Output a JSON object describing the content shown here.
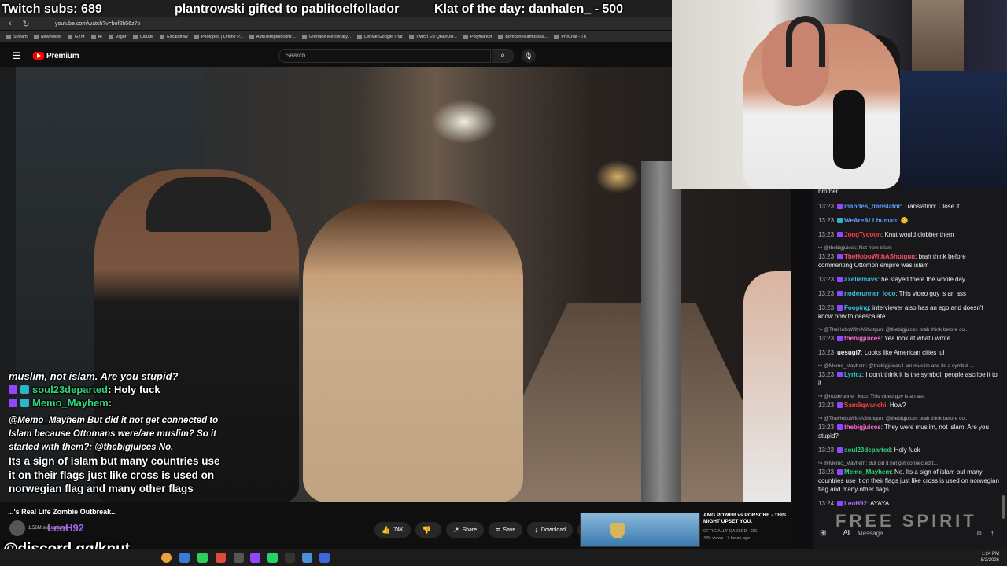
{
  "overlay": {
    "twitch_subs": "Twitch subs: 689",
    "gift": "plantrowski gifted to pablitoelfollador",
    "klat": "Klat of the day: danhalen_ - 500",
    "discord": "@discord.gg/knut",
    "watermark": "FREE SPIRIT"
  },
  "browser": {
    "url": "youtube.com/watch?v=bof2h56z7o",
    "bookmarks": [
      "Stream",
      "New folder",
      "GYM",
      "AI",
      "Viiger",
      "Claude",
      "Excalidraw",
      "Photopea | Online P...",
      "AutoTempest.com:...",
      "Grenade Mercenary...",
      "Let Me Google That",
      "Twitch EB QHD/UH...",
      "Polymarket",
      "Bombshell ambassa...",
      "ProChat - Th"
    ]
  },
  "youtube": {
    "logo_text": "Premium",
    "search_placeholder": "Search",
    "video_title_partial": "...'s Real Life Zombie Outbreak...",
    "channel_sub_count": "1.56M subscribers",
    "overlay_user": "LeoH92",
    "actions": {
      "likes": "74K",
      "share": "Share",
      "save": "Save",
      "download": "Download"
    },
    "recommended": {
      "title": "AMG POWER vs PORSCHE - THIS MIGHT UPSET YOU.",
      "channel": "OFFICIALLY GASSED - OG",
      "meta": "47K views • 7 hours ago"
    }
  },
  "video_chat": [
    {
      "type": "text",
      "text": "muslim, not islam. Are you stupid?"
    },
    {
      "type": "msg",
      "user": "soul23departed",
      "user_color": "#2fd67a",
      "text": ": Holy fuck"
    },
    {
      "type": "msg",
      "user": "Memo_Mayhem",
      "user_color": "#2fd67a",
      "text": ":"
    },
    {
      "type": "body",
      "text": "@Memo_Mayhem But did it not get connected to Islam because Ottomans were/are muslim? So it started with them?:  @thebigjuices No."
    },
    {
      "type": "big",
      "text": "Its a sign of islam but many countries use it on their flags just like cross is used on norwegian flag and many other flags"
    }
  ],
  "chat": {
    "messages": [
      {
        "kind": "cont",
        "text": "brother"
      },
      {
        "kind": "msg",
        "time": "13:23",
        "user": "mandes_translator",
        "color": "#5b9bff",
        "badge": "#9146ff",
        "text": ": Translation: Close it"
      },
      {
        "kind": "msg",
        "time": "13:23",
        "user": "WeAreALLhuman",
        "color": "#5b9bff",
        "badge": "#2cb5c7",
        "text": ": 🙂"
      },
      {
        "kind": "msg",
        "time": "13:23",
        "user": "JoogTycoon",
        "color": "#ff4040",
        "badge": "#9146ff",
        "text": ": Knut would clobber them"
      },
      {
        "kind": "reply",
        "text": "↪ @thebigjuices: Not from islam"
      },
      {
        "kind": "msg",
        "time": "13:23",
        "user": "TheHoboWithAShotgun",
        "color": "#ff4d6a",
        "badge": "#9146ff",
        "text": ": brah think before commenting Ottomon empire was islam"
      },
      {
        "kind": "msg",
        "time": "13:23",
        "user": "axellemavs",
        "color": "#3ac0e0",
        "badge": "#9146ff",
        "text": ": he stayed there the whole day"
      },
      {
        "kind": "msg",
        "time": "13:23",
        "user": "noderunner_loco",
        "color": "#3ac0e0",
        "badge": "#9146ff",
        "text": ": This video guy is an ass"
      },
      {
        "kind": "msg",
        "time": "13:23",
        "user": "Fooping",
        "color": "#3ac0e0",
        "badge": "#9146ff",
        "text": ": interviewer also has an ego and doesn't know how to deescalate"
      },
      {
        "kind": "reply",
        "text": "↪ @TheHoboWithAShotgun: @thebigjuices brah think before co..."
      },
      {
        "kind": "msg",
        "time": "13:23",
        "user": "thebigjuices",
        "color": "#ff6bd6",
        "badge": "#9146ff",
        "text": ": Yea look at what i wrote"
      },
      {
        "kind": "msg",
        "time": "13:23",
        "user": "uesugi7",
        "color": "#efeff1",
        "badge": "",
        "text": ": Looks like American cities lul"
      },
      {
        "kind": "reply",
        "text": "↪ @Memo_Mayhem: @thebigjuices I am muslim and its a symbol ..."
      },
      {
        "kind": "msg",
        "time": "13:23",
        "user": "Lyricz",
        "color": "#3ac0e0",
        "badge": "#9146ff",
        "text": ": I don't think it is the symbol, people ascribe it to it"
      },
      {
        "kind": "reply",
        "text": "↪ @noderunner_loco: This video guy is an ass"
      },
      {
        "kind": "msg",
        "time": "13:23",
        "user": "Sam6qwanchi",
        "color": "#ff4040",
        "badge": "#9146ff",
        "text": ": How?"
      },
      {
        "kind": "reply",
        "text": "↪ @TheHoboWithAShotgun: @thebigjuices brah think before co..."
      },
      {
        "kind": "msg",
        "time": "13:23",
        "user": "thebigjuices",
        "color": "#ff6bd6",
        "badge": "#9146ff",
        "text": ": They were muslim, not islam. Are you stupid?"
      },
      {
        "kind": "msg",
        "time": "13:23",
        "user": "soul23departed",
        "color": "#2fd67a",
        "badge": "#9146ff",
        "text": ": Holy fuck"
      },
      {
        "kind": "reply",
        "text": "↪ @Memo_Mayhem: But did it not get connected t..."
      },
      {
        "kind": "msg",
        "time": "13:23",
        "user": "Memo_Mayhem",
        "color": "#2fd67a",
        "badge": "#9146ff",
        "text": ": No. Its a sign of islam but many countries use it on their flags just like cross is used on norwegian flag and many other flags"
      },
      {
        "kind": "msg",
        "time": "13:24",
        "user": "LeoH92",
        "color": "#b06cff",
        "badge": "#9146ff",
        "text": ": AYAYA"
      }
    ],
    "filter": "All",
    "input_placeholder": "Message"
  },
  "taskbar": {
    "time": "1:24 PM",
    "date": "8/2/2026"
  }
}
